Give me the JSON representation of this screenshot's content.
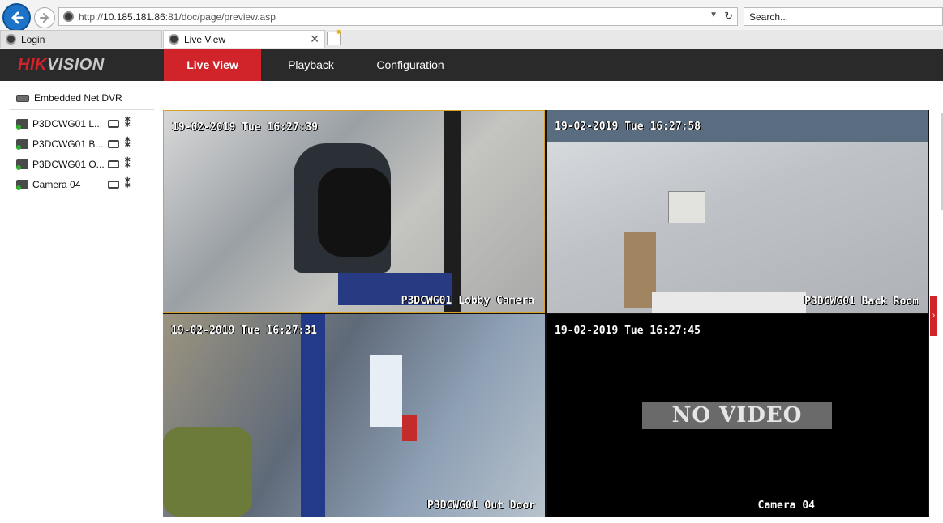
{
  "browser": {
    "url_prefix": "http://",
    "url_host": "10.185.181.86",
    "url_rest": ":81/doc/page/preview.asp",
    "search_placeholder": "Search...",
    "tabs": [
      {
        "label": "Login"
      },
      {
        "label": "Live View"
      }
    ]
  },
  "app": {
    "logo_hik": "HIK",
    "logo_vision": "VISION",
    "nav": {
      "live": "Live View",
      "playback": "Playback",
      "configuration": "Configuration"
    }
  },
  "sidebar": {
    "device": "Embedded Net DVR",
    "cameras": [
      {
        "label": "P3DCWG01 L..."
      },
      {
        "label": "P3DCWG01 B..."
      },
      {
        "label": "P3DCWG01 O..."
      },
      {
        "label": "Camera 04"
      }
    ]
  },
  "videos": [
    {
      "timestamp": "19-02-2019 Tue 16:27:39",
      "name": "P3DCWG01 Lobby Camera"
    },
    {
      "timestamp": "19-02-2019 Tue 16:27:58",
      "name": "P3DCWG01 Back Room"
    },
    {
      "timestamp": "19-02-2019 Tue 16:27:31",
      "name": "P3DCWG01 Out Door"
    },
    {
      "timestamp": "19-02-2019 Tue 16:27:45",
      "name": "Camera 04",
      "status": "NO VIDEO"
    }
  ],
  "colors": {
    "accent": "#d0232a",
    "header_bg": "#2a2a2a",
    "selected_border": "#d8a128"
  }
}
